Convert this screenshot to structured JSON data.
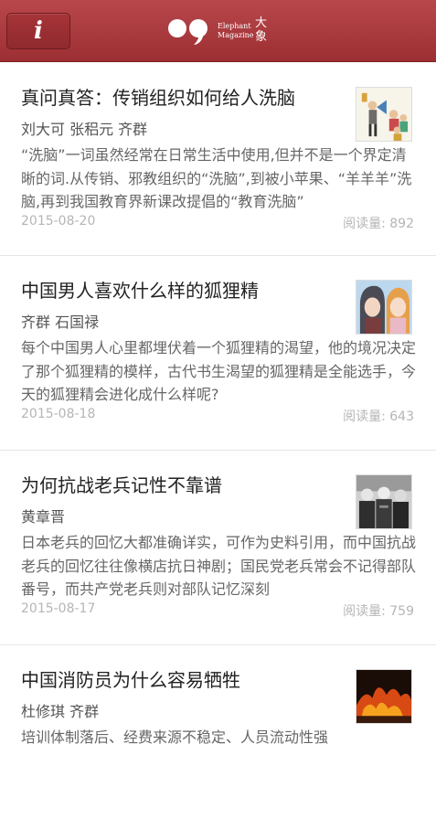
{
  "header": {
    "info_icon_glyph": "i",
    "logo_en_line1": "Elephant",
    "logo_en_line2": "Magazine",
    "logo_cn": "大象",
    "bar_color": "#a9393d"
  },
  "articles": [
    {
      "title": "真问真答：传销组织如何给人洗脑",
      "authors": "刘大可 张稆元 齐群",
      "summary": "“洗脑”一词虽然经常在日常生活中使用,但并不是一个界定清晰的词.从传销、邪教组织的“洗脑”,到被小苹果、“羊羊羊”洗脑,再到我国教育界新课改提倡的“教育洗脑”",
      "date": "2015-08-20",
      "read_label": "阅读量: ",
      "read_count": "892",
      "thumb_icon": "cartoon-megaphone-thumbnail"
    },
    {
      "title": "中国男人喜欢什么样的狐狸精",
      "authors": "齐群 石国禄",
      "summary": "每个中国男人心里都埋伏着一个狐狸精的渴望，他的境况决定了那个狐狸精的模样，古代书生渴望的狐狸精是全能选手，今天的狐狸精会进化成什么样呢?",
      "date": "2015-08-18",
      "read_label": "阅读量: ",
      "read_count": "643",
      "thumb_icon": "anime-characters-thumbnail"
    },
    {
      "title": "为何抗战老兵记性不靠谱",
      "authors": "黄章晋",
      "summary": "日本老兵的回忆大都准确详实，可作为史料引用，而中国抗战老兵的回忆往往像横店抗日神剧；国民党老兵常会不记得部队番号，而共产党老兵则对部队记忆深刻",
      "date": "2015-08-17",
      "read_label": "阅读量: ",
      "read_count": "759",
      "thumb_icon": "veterans-photo-thumbnail"
    },
    {
      "title": "中国消防员为什么容易牺牲",
      "authors": "杜修琪 齐群",
      "summary": "培训体制落后、经费来源不稳定、人员流动性强",
      "thumb_icon": "fire-photo-thumbnail"
    }
  ]
}
